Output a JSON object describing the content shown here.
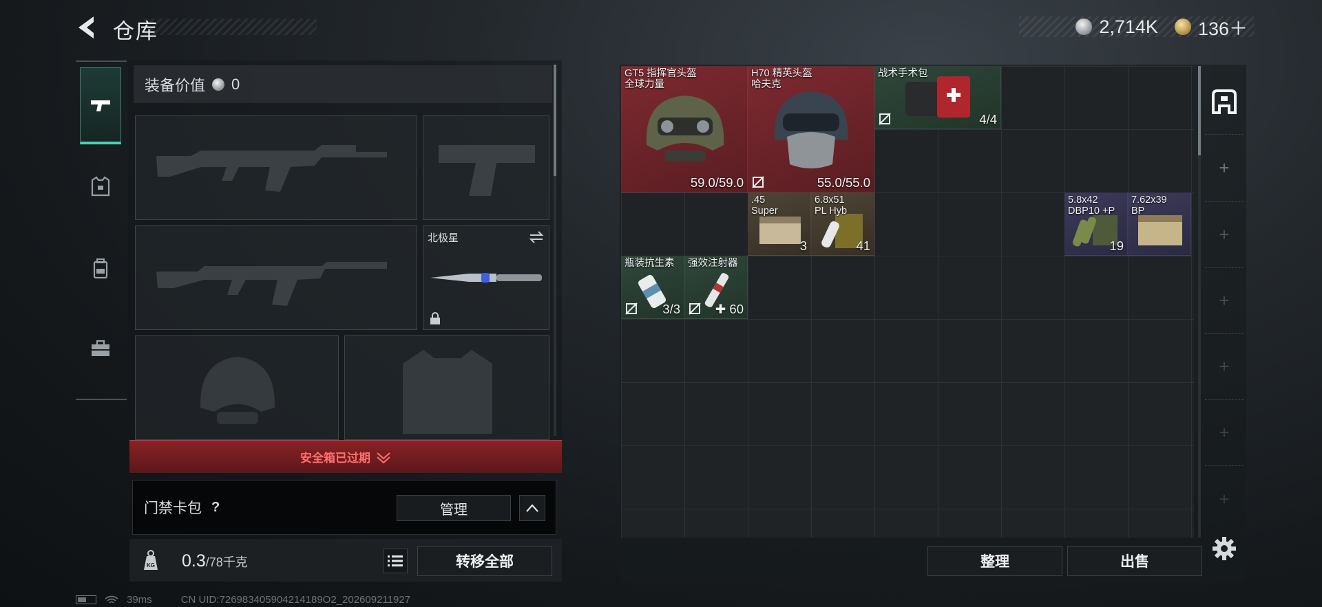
{
  "header": {
    "title": "仓库",
    "currency": [
      {
        "icon": "silver-coin-icon",
        "value": "2,714K"
      },
      {
        "icon": "gold-coin-icon",
        "value": "136＋"
      }
    ]
  },
  "side_tabs": [
    {
      "name": "weapons",
      "icon": "pistol-icon",
      "active": true
    },
    {
      "name": "gear",
      "icon": "vest-icon",
      "active": false
    },
    {
      "name": "backpack",
      "icon": "backpack-icon",
      "active": false
    },
    {
      "name": "toolbox",
      "icon": "briefcase-icon",
      "active": false
    }
  ],
  "loadout": {
    "equip_value_label": "装备价值",
    "equip_value": "0",
    "melee_name": "北极星",
    "safe_box_status": "安全箱已过期",
    "keycard_label": "门禁卡包",
    "help_mark": "?",
    "manage_label": "管理",
    "weight_current": "0.3",
    "weight_max": "/78千克",
    "transfer_all_label": "转移全部"
  },
  "storage": {
    "items": [
      {
        "name_line1": "GT5 指挥官头盔",
        "name_line2": "全球力量",
        "qty": "59.0/59.0",
        "rarity": "red"
      },
      {
        "name_line1": "H70 精英头盔",
        "name_line2": "哈夫克",
        "qty": "55.0/55.0",
        "rarity": "red"
      },
      {
        "name_line1": "战术手术包",
        "name_line2": "",
        "qty": "4/4",
        "rarity": "green"
      },
      {
        "name_line1": ".45",
        "name_line2": "Super",
        "qty": "3",
        "rarity": "brown"
      },
      {
        "name_line1": "6.8x51",
        "name_line2": "PL Hyb",
        "qty": "41",
        "rarity": "brown"
      },
      {
        "name_line1": "5.8x42",
        "name_line2": "DBP10 +P",
        "qty": "19",
        "rarity": "purple"
      },
      {
        "name_line1": "7.62x39",
        "name_line2": "BP",
        "qty": "",
        "rarity": "purple"
      },
      {
        "name_line1": "瓶装抗生素",
        "name_line2": "",
        "qty": "3/3",
        "rarity": "green"
      },
      {
        "name_line1": "强效注射器",
        "name_line2": "",
        "qty": "60",
        "rarity": "green"
      }
    ],
    "sort_label": "整理",
    "sell_label": "出售"
  },
  "status_bar": {
    "ping": "39ms",
    "uid": "CN UID:726983405904214189O2_202609211927"
  },
  "colors": {
    "red_rarity": "#7d2a30",
    "green_rarity": "#2f473a",
    "purple_rarity": "#3c3a5a",
    "brown_rarity": "#4d4536",
    "accent_teal": "#4ad3b3",
    "alert_red": "#ff6f6f"
  }
}
